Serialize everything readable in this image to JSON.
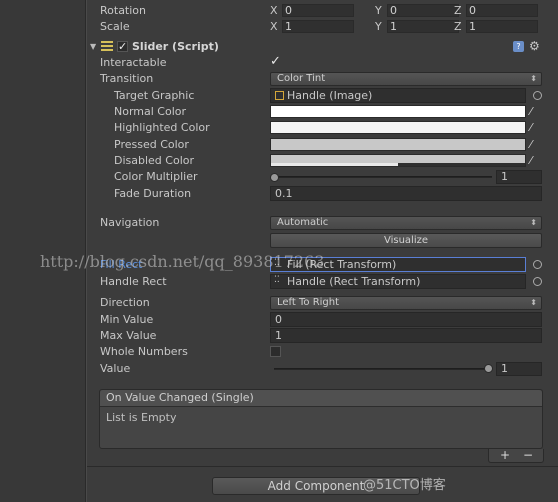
{
  "transform": {
    "rotation_label": "Rotation",
    "scale_label": "Scale",
    "rotation": {
      "x_label": "X",
      "x": "0",
      "y_label": "Y",
      "y": "0",
      "z_label": "Z",
      "z": "0"
    },
    "scale": {
      "x_label": "X",
      "x": "1",
      "y_label": "Y",
      "y": "1",
      "z_label": "Z",
      "z": "1"
    }
  },
  "component": {
    "title": "Slider (Script)",
    "enabled": true,
    "help_icon": "help-book-icon",
    "settings_icon": "gear-icon"
  },
  "slider": {
    "interactable_label": "Interactable",
    "interactable": true,
    "transition_label": "Transition",
    "transition_value": "Color Tint",
    "target_graphic_label": "Target Graphic",
    "target_graphic_value": "Handle (Image)",
    "normal_color_label": "Normal Color",
    "highlighted_color_label": "Highlighted Color",
    "pressed_color_label": "Pressed Color",
    "disabled_color_label": "Disabled Color",
    "color_multiplier_label": "Color Multiplier",
    "color_multiplier_value": "1",
    "fade_duration_label": "Fade Duration",
    "fade_duration_value": "0.1",
    "navigation_label": "Navigation",
    "navigation_value": "Automatic",
    "visualize_label": "Visualize",
    "fill_rect_label": "Fill Rect",
    "fill_rect_value": "Fill (Rect Transform)",
    "handle_rect_label": "Handle Rect",
    "handle_rect_value": "Handle (Rect Transform)",
    "direction_label": "Direction",
    "direction_value": "Left To Right",
    "min_value_label": "Min Value",
    "min_value": "0",
    "max_value_label": "Max Value",
    "max_value": "1",
    "whole_numbers_label": "Whole Numbers",
    "whole_numbers": false,
    "value_label": "Value",
    "value": "1"
  },
  "colors": {
    "normal": "#ffffff",
    "highlighted": "#f5f5f5",
    "pressed": "#c8c8c8",
    "disabled": "#c8c8c8",
    "disabled_alpha": 0.5,
    "accent_selected": "#5a7fd6"
  },
  "event": {
    "header": "On Value Changed (Single)",
    "empty_text": "List is Empty",
    "add_symbol": "+",
    "remove_symbol": "−"
  },
  "add_component_label": "Add Component",
  "watermark": "http://blog.csdn.net/qq_893817263",
  "watermark_site": "@51CTO博客"
}
